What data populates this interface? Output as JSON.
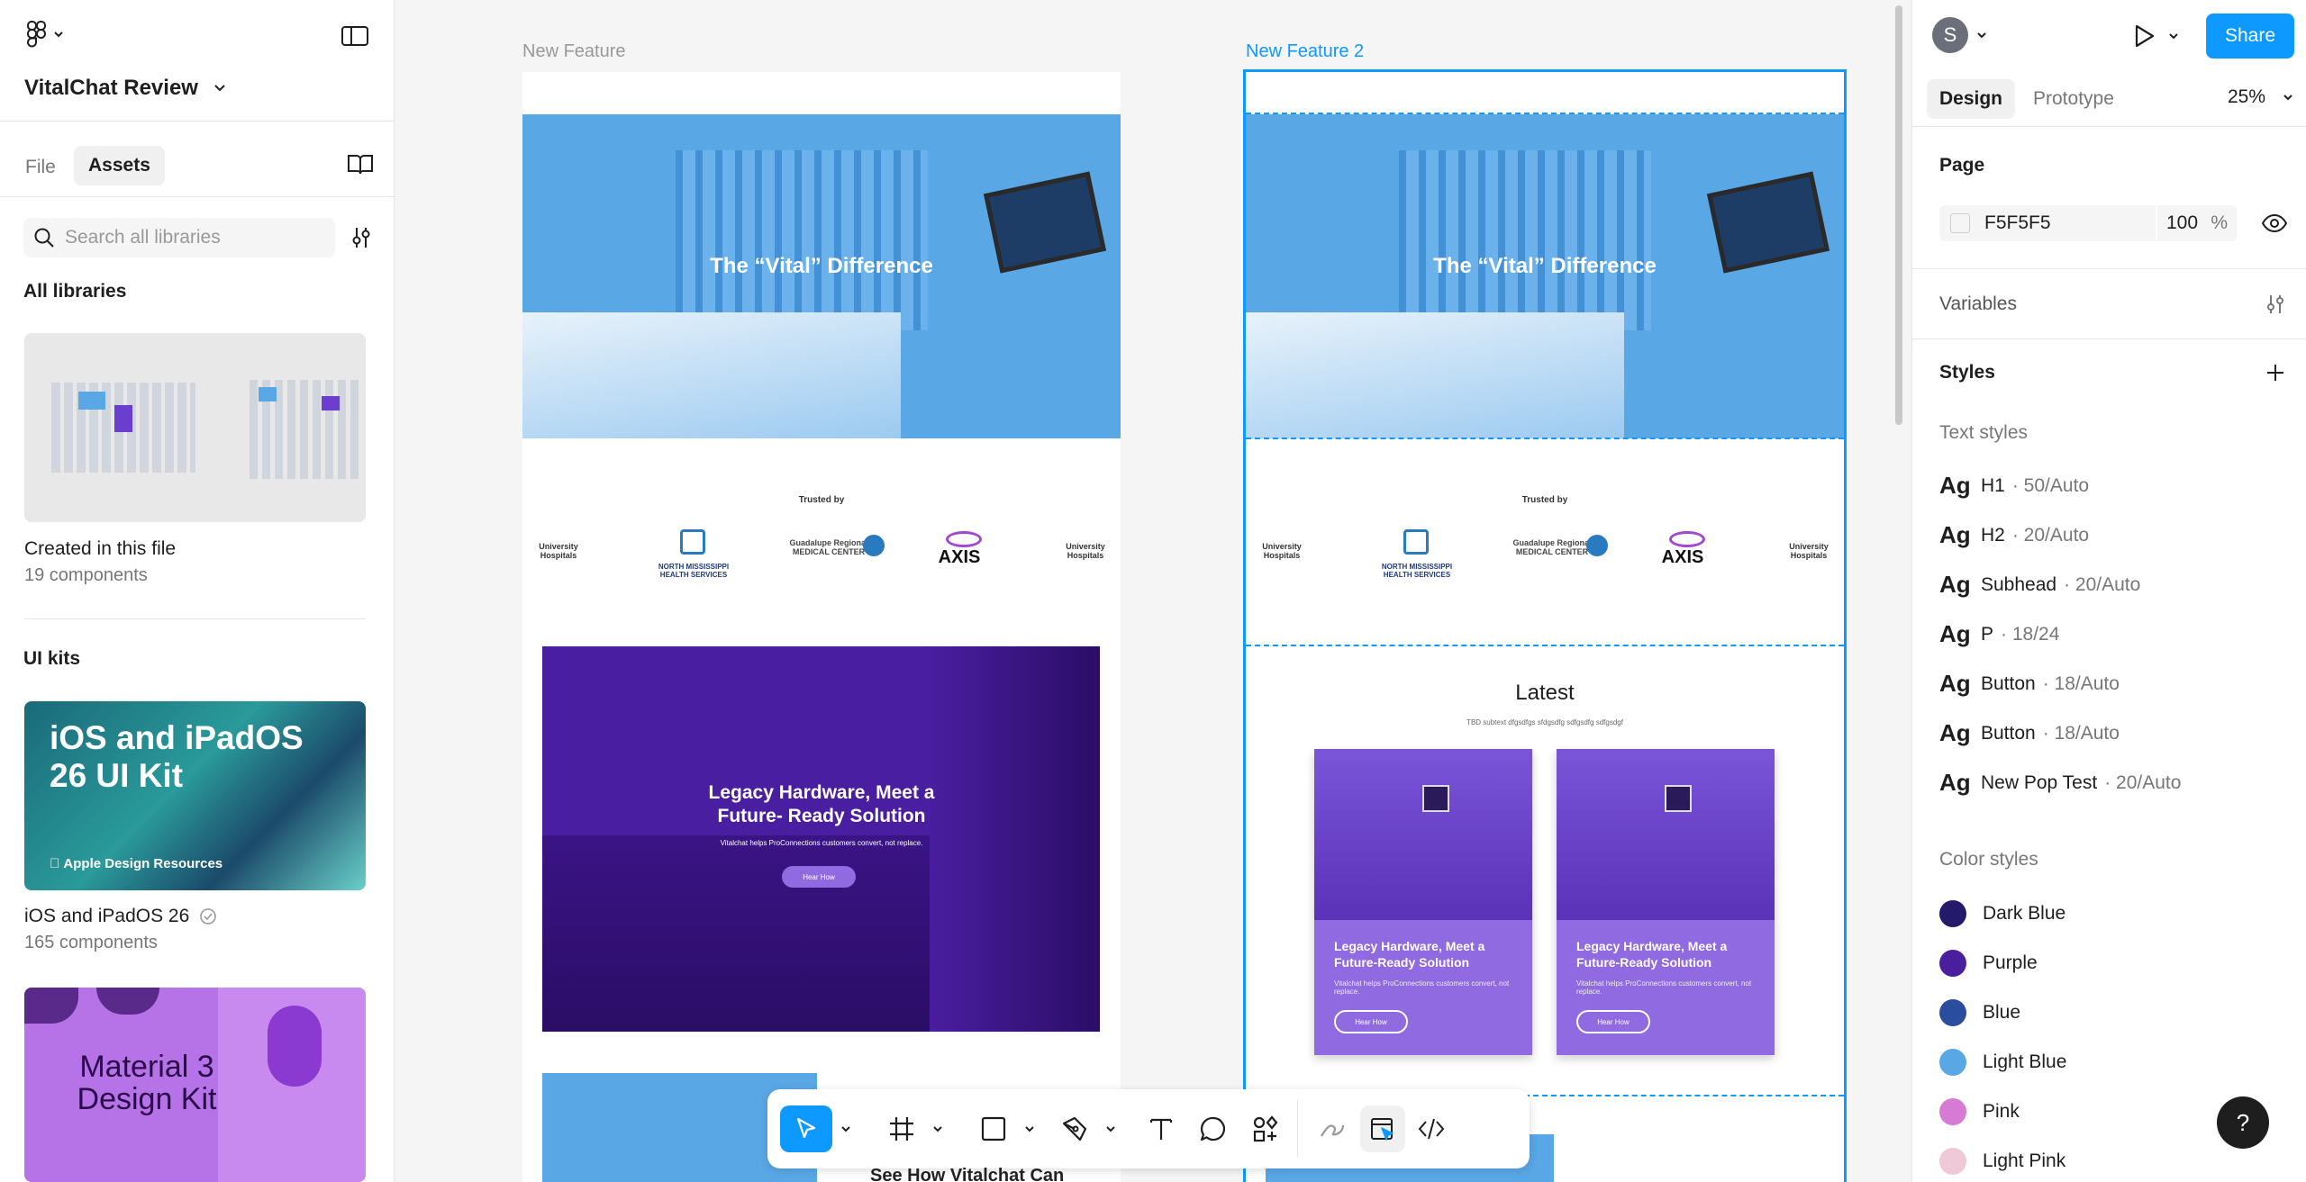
{
  "file": {
    "name": "VitalChat Review"
  },
  "left_panel": {
    "tabs": [
      "File",
      "Assets"
    ],
    "search_placeholder": "Search all libraries",
    "all_libraries": "All libraries",
    "created_title": "Created in this file",
    "created_count": "19 components",
    "ui_kits": "UI kits",
    "kits": [
      {
        "name": "iOS and iPadOS 26",
        "count": "165 components",
        "thumb_title": "iOS and iPadOS 26 UI Kit",
        "thumb_sub": "Apple Design Resources"
      },
      {
        "name": "Material 3 Design Kit",
        "thumb_title": "Material 3 Design Kit"
      }
    ]
  },
  "canvas": {
    "frame1_label": "New Feature",
    "frame2_label": "New Feature 2",
    "hero_title": "The “Vital” Difference",
    "trusted_by": "Trusted by",
    "logos": [
      "University Hospitals",
      "NORTH MISSISSIPPI HEALTH SERVICES",
      "Guadalupe Regional MEDICAL CENTER",
      "AXIS",
      "University Hospitals"
    ],
    "legacy_title": "Legacy Hardware, Meet a Future- Ready Solution",
    "legacy_sub": "Vitalchat helps ProConnections customers convert, not replace.",
    "legacy_button": "Hear How",
    "latest_title": "Latest",
    "latest_sub": "TBD subtext dfgsdfgs sfdgsdfg sdfgsdfg sdfgsdgf",
    "card_title": "Legacy Hardware, Meet a Future-Ready Solution",
    "card_sub": "Vitalchat helps ProConnections customers convert, not replace.",
    "card_button": "Hear How",
    "see_how": "See How Vitalchat Can"
  },
  "right_panel": {
    "avatar_letter": "S",
    "share": "Share",
    "tabs": [
      "Design",
      "Prototype"
    ],
    "zoom": "25%",
    "page_label": "Page",
    "page_color": "F5F5F5",
    "page_opacity": "100",
    "percent": "%",
    "variables": "Variables",
    "styles": "Styles",
    "text_styles_label": "Text styles",
    "text_styles": [
      {
        "ag": "Ag",
        "name": "H1",
        "meta": "· 50/Auto"
      },
      {
        "ag": "Ag",
        "name": "H2",
        "meta": "· 20/Auto"
      },
      {
        "ag": "Ag",
        "name": "Subhead",
        "meta": "· 20/Auto"
      },
      {
        "ag": "Ag",
        "name": "P",
        "meta": "· 18/24"
      },
      {
        "ag": "Ag",
        "name": "Button",
        "meta": "· 18/Auto"
      },
      {
        "ag": "Ag",
        "name": "Button",
        "meta": "· 18/Auto"
      },
      {
        "ag": "Ag",
        "name": "New Pop Test",
        "meta": "· 20/Auto"
      }
    ],
    "color_styles_label": "Color styles",
    "color_styles": [
      {
        "name": "Dark Blue",
        "color": "#241a6b"
      },
      {
        "name": "Purple",
        "color": "#4b1e9e"
      },
      {
        "name": "Blue",
        "color": "#2a4d9e"
      },
      {
        "name": "Light Blue",
        "color": "#5aa7e6"
      },
      {
        "name": "Pink",
        "color": "#d67ad6"
      },
      {
        "name": "Light Pink",
        "color": "#efc9d8"
      }
    ],
    "help": "?"
  },
  "colors": {
    "accent": "#0d99ff",
    "hero_blue": "#5aa7e6",
    "purple": "#4a1ea0",
    "card_purple": "#8f6ae0"
  }
}
